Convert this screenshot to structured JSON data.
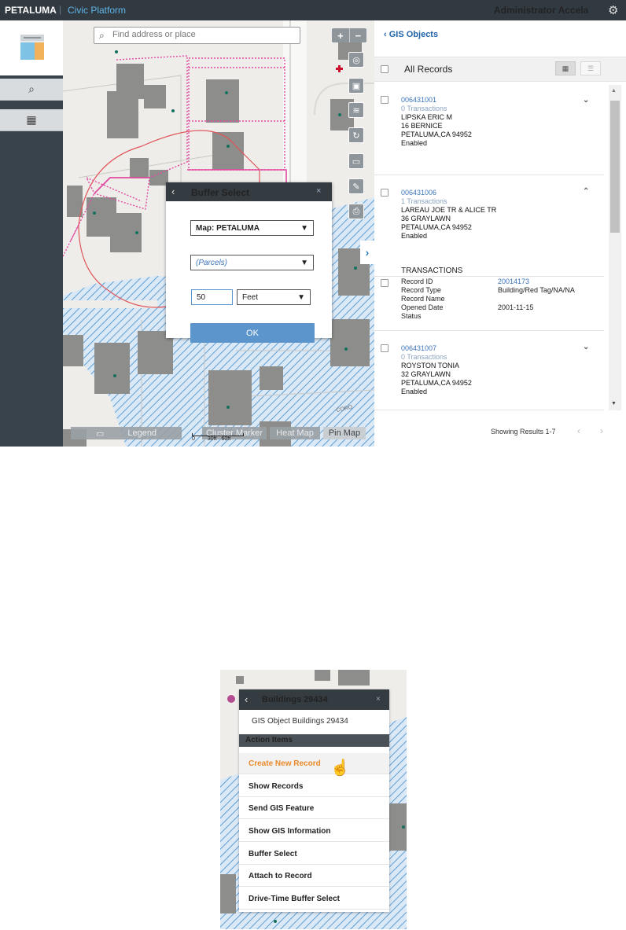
{
  "header": {
    "brand": "PETALUMA",
    "separator": "|",
    "product": "Civic Platform",
    "user": "Administrator Accela",
    "settings_icon": "gear-icon"
  },
  "sidebar": {
    "items": [
      {
        "icon": "search-icon",
        "glyph": "⌕"
      },
      {
        "icon": "apps-grid-icon",
        "glyph": "▦"
      }
    ]
  },
  "map": {
    "search_placeholder": "Find address or place",
    "zoom_in": "+",
    "zoom_out": "−",
    "street_label": "CORO",
    "bottom_bar": {
      "legend": "Legend",
      "cluster": "Cluster Marker",
      "heat": "Heat Map",
      "pin": "Pin Map"
    },
    "scale": {
      "zero": "0",
      "mid": "30ft",
      "end": "60ft"
    }
  },
  "buffer_dialog": {
    "title": "Buffer Select",
    "map_select": "Map: PETALUMA",
    "layer_select": "(Parcels)",
    "distance": "50",
    "unit": "Feet",
    "ok": "OK",
    "close": "×"
  },
  "records_panel": {
    "back_link": "GIS Objects",
    "all_records": "All Records",
    "records": [
      {
        "id": "006431001",
        "tx": "0 Transactions",
        "name": "LIPSKA ERIC M",
        "street": "16 BERNICE",
        "city": "PETALUMA,CA 94952",
        "status": "Enabled"
      },
      {
        "id": "006431006",
        "tx": "1 Transactions",
        "name": "LAREAU JOE TR & ALICE TR",
        "street": "36 GRAYLAWN",
        "city": "PETALUMA,CA 94952",
        "status": "Enabled"
      },
      {
        "id": "006431007",
        "tx": "0 Transactions",
        "name": "ROYSTON TONIA",
        "street": "32 GRAYLAWN",
        "city": "PETALUMA,CA 94952",
        "status": "Enabled"
      }
    ],
    "transactions": {
      "heading": "TRANSACTIONS",
      "rows": [
        {
          "key": "Record ID",
          "value": "20014173"
        },
        {
          "key": "Record Type",
          "value": "Building/Red Tag/NA/NA"
        },
        {
          "key": "Record Name",
          "value": ""
        },
        {
          "key": "Opened Date",
          "value": "2001-11-15"
        },
        {
          "key": "Status",
          "value": ""
        }
      ]
    },
    "footer": "Showing Results 1-7"
  },
  "gis_popup": {
    "title": "Buildings 29434",
    "subtitle": "GIS Object Buildings 29434",
    "close": "×",
    "action_header": "Action Items",
    "items": [
      "Create New Record",
      "Show Records",
      "Send GIS Feature",
      "Show GIS Information",
      "Buffer Select",
      "Attach to Record",
      "Drive-Time Buffer Select"
    ]
  }
}
